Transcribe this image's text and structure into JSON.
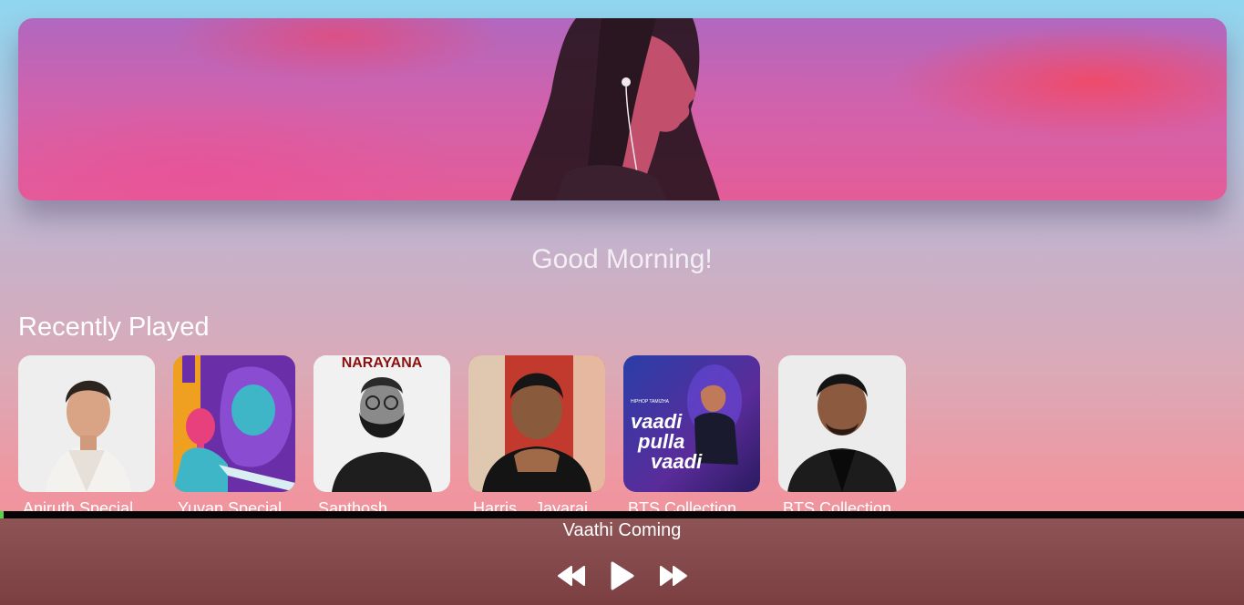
{
  "greeting": "Good Morning!",
  "recently_played": {
    "title": "Recently Played",
    "items": [
      {
        "label": "Aniruth Special"
      },
      {
        "label": "Yuvan Special"
      },
      {
        "label": "Santhosh"
      },
      {
        "label": "Harris    Jayaraj"
      },
      {
        "label": "BTS Collection"
      },
      {
        "label": "BTS Collection"
      }
    ],
    "art_text": {
      "santhosh_banner": "NARAYANA",
      "hiphop_small": "HIPHOP TAMIZHA",
      "hiphop_title_1": "vaadi",
      "hiphop_title_2": "pulla",
      "hiphop_title_3": "vaadi"
    }
  },
  "player": {
    "now_playing": "Vaathi Coming",
    "progress": 0.003,
    "controls": {
      "rewind_icon": "rewind-icon",
      "play_icon": "play-icon",
      "forward_icon": "fast-forward-icon"
    },
    "colors": {
      "progress_fill": "#59d34a",
      "track": "#050505",
      "bar_top": "#8f5557",
      "bar_bottom": "#7b3f42"
    }
  }
}
